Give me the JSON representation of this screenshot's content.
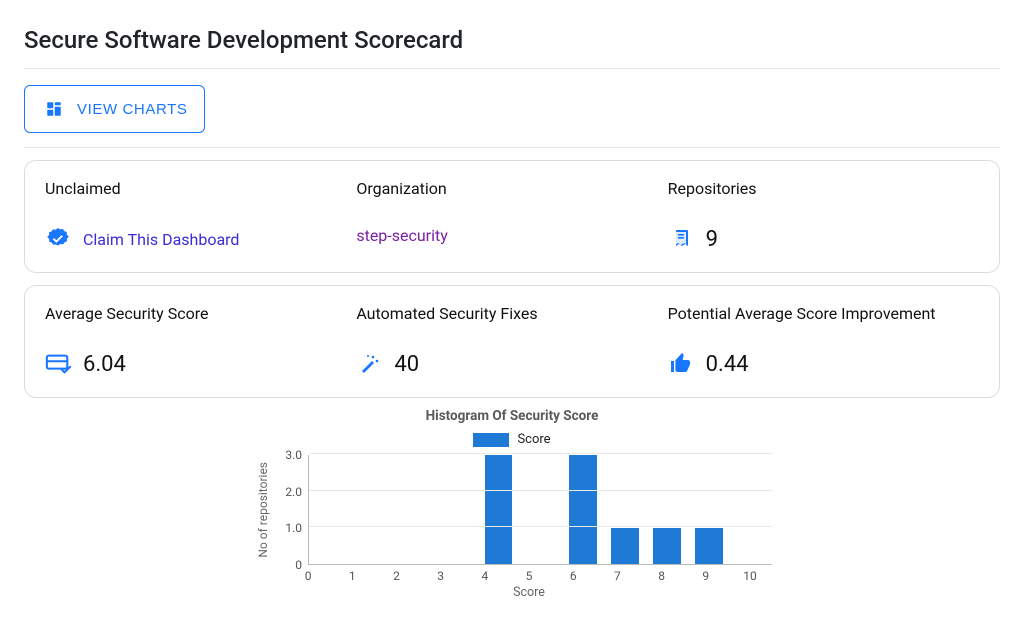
{
  "page": {
    "title": "Secure Software Development Scorecard"
  },
  "toolbar": {
    "view_charts_label": "VIEW CHARTS"
  },
  "summary_row_1": {
    "claim": {
      "label": "Unclaimed",
      "link_text": "Claim This Dashboard"
    },
    "organization": {
      "label": "Organization",
      "value": "step-security"
    },
    "repositories": {
      "label": "Repositories",
      "value": "9"
    }
  },
  "summary_row_2": {
    "avg_score": {
      "label": "Average Security Score",
      "value": "6.04"
    },
    "auto_fixes": {
      "label": "Automated Security Fixes",
      "value": "40"
    },
    "potential_improvement": {
      "label": "Potential Average Score Improvement",
      "value": "0.44"
    }
  },
  "chart_data": {
    "type": "bar",
    "title": "Histogram Of Security Score",
    "legend": "Score",
    "xlabel": "Score",
    "ylabel": "No of repositories",
    "categories": [
      "0",
      "1",
      "2",
      "3",
      "4",
      "5",
      "6",
      "7",
      "8",
      "9",
      "10"
    ],
    "values": [
      0,
      0,
      0,
      0,
      3,
      0,
      3,
      1,
      1,
      1,
      0
    ],
    "y_ticks": [
      "0",
      "1.0",
      "2.0",
      "3.0"
    ],
    "ylim": [
      0,
      3
    ],
    "bar_color": "#1f7ad6"
  }
}
